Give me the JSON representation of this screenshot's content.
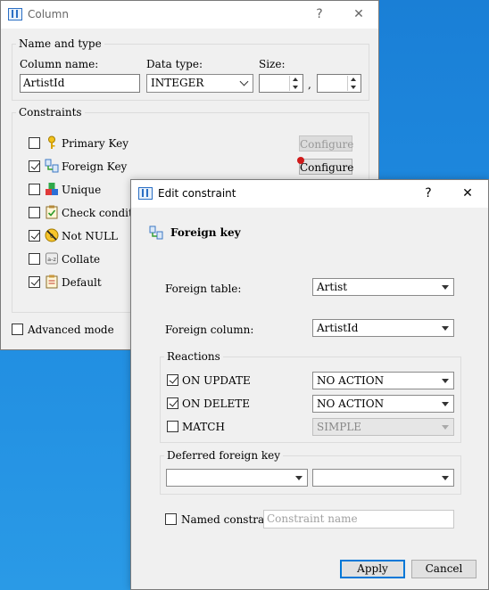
{
  "column_dialog": {
    "title": "Column",
    "help": "?",
    "close": "✕",
    "name_type_group": "Name and type",
    "column_name_label": "Column name:",
    "column_name_value": "ArtistId",
    "data_type_label": "Data type:",
    "data_type_value": "INTEGER",
    "size_label": "Size:",
    "size_separator": ",",
    "constraints_group": "Constraints",
    "constraints": [
      {
        "label": "Primary Key",
        "checked": false,
        "icon": "key-icon"
      },
      {
        "label": "Foreign Key",
        "checked": true,
        "icon": "foreign-key-icon"
      },
      {
        "label": "Unique",
        "checked": false,
        "icon": "unique-icon"
      },
      {
        "label": "Check condition",
        "checked": false,
        "icon": "check-condition-icon"
      },
      {
        "label": "Not NULL",
        "checked": true,
        "icon": "not-null-icon"
      },
      {
        "label": "Collate",
        "checked": false,
        "icon": "collate-icon"
      },
      {
        "label": "Default",
        "checked": true,
        "icon": "default-icon"
      }
    ],
    "configure_label": "Configure",
    "advanced_mode_label": "Advanced mode"
  },
  "edit_dialog": {
    "title": "Edit constraint",
    "help": "?",
    "close": "✕",
    "heading": "Foreign key",
    "foreign_table_label": "Foreign table:",
    "foreign_table_value": "Artist",
    "foreign_column_label": "Foreign column:",
    "foreign_column_value": "ArtistId",
    "reactions_group": "Reactions",
    "on_update_label": "ON UPDATE",
    "on_update_value": "NO ACTION",
    "on_delete_label": "ON DELETE",
    "on_delete_value": "NO ACTION",
    "match_label": "MATCH",
    "match_value": "SIMPLE",
    "deferred_group": "Deferred foreign key",
    "named_constraint_label": "Named constraint",
    "constraint_name_placeholder": "Constraint name",
    "apply_label": "Apply",
    "cancel_label": "Cancel"
  },
  "colors": {
    "accent": "#0078d7",
    "desktop": "#1f8be0",
    "error_badge": "#d01a1a"
  }
}
